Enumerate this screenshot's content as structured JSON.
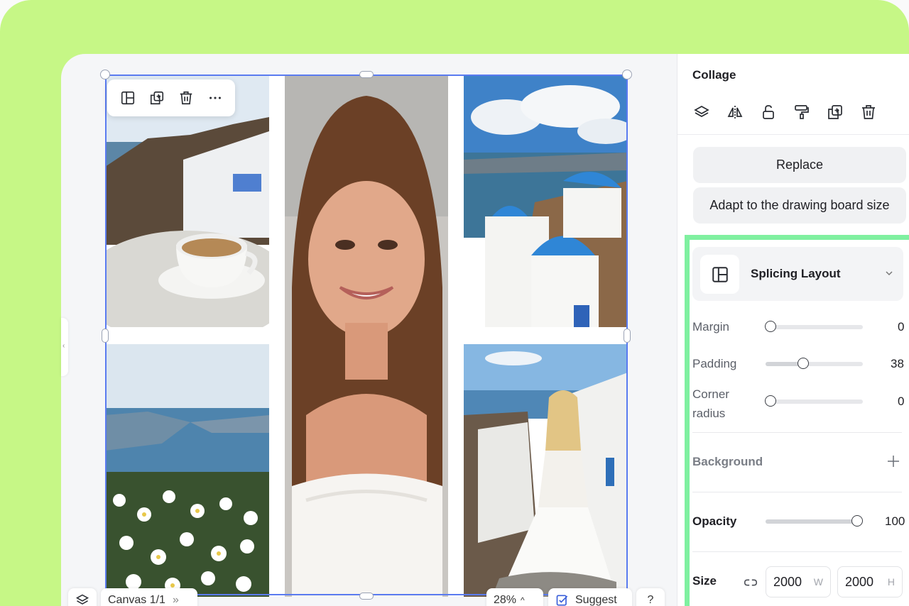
{
  "panel": {
    "title": "Collage",
    "replace_label": "Replace",
    "adapt_label": "Adapt to the drawing board size",
    "layout_label": "Splicing Layout",
    "margin_label": "Margin",
    "margin_value": "0",
    "padding_label": "Padding",
    "padding_value": "38",
    "corner_label": "Corner radius",
    "corner_value": "0",
    "background_label": "Background",
    "opacity_label": "Opacity",
    "opacity_value": "100",
    "size_label": "Size",
    "width_value": "2000",
    "width_unit": "W",
    "height_value": "2000",
    "height_unit": "H",
    "icons": [
      "layers-icon",
      "flip-icon",
      "unlock-icon",
      "paint-roller-icon",
      "duplicate-icon",
      "trash-icon"
    ]
  },
  "toolbar": {
    "icons": [
      "layout-icon",
      "duplicate-icon",
      "trash-icon",
      "more-icon"
    ]
  },
  "bottom": {
    "canvas_label": "Canvas 1/1",
    "zoom": "28%",
    "suggest_label": "Suggest",
    "help": "?"
  },
  "colors": {
    "frame": "#c6f786",
    "selection": "#5a7bf0",
    "highlight": "#7ff0a0"
  }
}
